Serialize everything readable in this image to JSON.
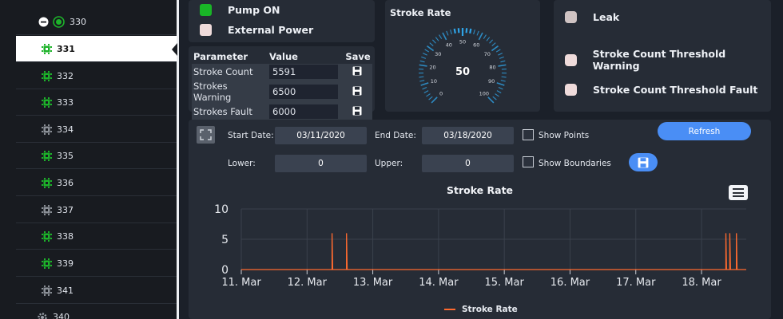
{
  "sidebar": {
    "items": [
      {
        "label": "330",
        "status": "ok"
      },
      {
        "label": "331",
        "status": "ok"
      },
      {
        "label": "332",
        "status": "ok"
      },
      {
        "label": "333",
        "status": "ok"
      },
      {
        "label": "334",
        "status": "offline"
      },
      {
        "label": "335",
        "status": "ok"
      },
      {
        "label": "336",
        "status": "ok"
      },
      {
        "label": "337",
        "status": "offline"
      },
      {
        "label": "338",
        "status": "ok"
      },
      {
        "label": "339",
        "status": "ok"
      },
      {
        "label": "341",
        "status": "offline"
      },
      {
        "label": "340",
        "status": "group"
      }
    ],
    "selected": "331"
  },
  "status": {
    "pump_on": {
      "label": "Pump ON",
      "color": "#19b527"
    },
    "external_power": {
      "label": "External Power",
      "color": "#efdbdb"
    }
  },
  "params": {
    "headers": {
      "parameter": "Parameter",
      "value": "Value",
      "save": "Save"
    },
    "rows": [
      {
        "name": "Stroke Count",
        "value": "5591"
      },
      {
        "name": "Strokes Warning",
        "value": "6500"
      },
      {
        "name": "Strokes Fault",
        "value": "6000"
      }
    ]
  },
  "gauge": {
    "title": "Stroke Rate",
    "value": "50",
    "min": 0,
    "max": 100,
    "ticks": [
      "0",
      "10",
      "20",
      "30",
      "40",
      "50",
      "60",
      "70",
      "80",
      "90",
      "100"
    ],
    "color": "#2fa3e6"
  },
  "alarms": [
    {
      "label": "Leak",
      "color": "#cfc3c3"
    },
    {
      "label": "Stroke Count Threshold Warning",
      "color": "#efdbdb"
    },
    {
      "label": "Stroke Count Threshold Fault",
      "color": "#efdbdb"
    }
  ],
  "controls": {
    "start_label": "Start Date:",
    "start_value": "03/11/2020",
    "end_label": "End Date:",
    "end_value": "03/18/2020",
    "show_points": "Show Points",
    "refresh": "Refresh",
    "lower_label": "Lower:",
    "lower_value": "0",
    "upper_label": "Upper:",
    "upper_value": "0",
    "show_boundaries": "Show Boundaries",
    "accent": "#4a8ef5"
  },
  "chart_data": {
    "type": "line",
    "title": "Stroke Rate",
    "xlabel": "",
    "ylabel": "",
    "x_ticks": [
      "11. Mar",
      "12. Mar",
      "13. Mar",
      "14. Mar",
      "15. Mar",
      "16. Mar",
      "17. Mar",
      "18. Mar"
    ],
    "y_ticks": [
      0,
      5,
      10
    ],
    "ylim": [
      0,
      10
    ],
    "xlim_days": [
      11,
      18.68
    ],
    "grid": true,
    "legend": "bottom",
    "series": [
      {
        "name": "Stroke Rate",
        "color": "#ff6a2f",
        "points_day_value": [
          [
            11,
            0
          ],
          [
            12.38,
            0
          ],
          [
            12.38,
            6
          ],
          [
            12.39,
            0
          ],
          [
            12.6,
            0
          ],
          [
            12.6,
            6
          ],
          [
            12.61,
            0
          ],
          [
            18.37,
            0
          ],
          [
            18.37,
            6
          ],
          [
            18.38,
            0
          ],
          [
            18.43,
            0
          ],
          [
            18.43,
            6
          ],
          [
            18.44,
            0
          ],
          [
            18.53,
            0
          ],
          [
            18.53,
            6
          ],
          [
            18.54,
            0
          ],
          [
            18.68,
            0
          ]
        ]
      }
    ]
  }
}
